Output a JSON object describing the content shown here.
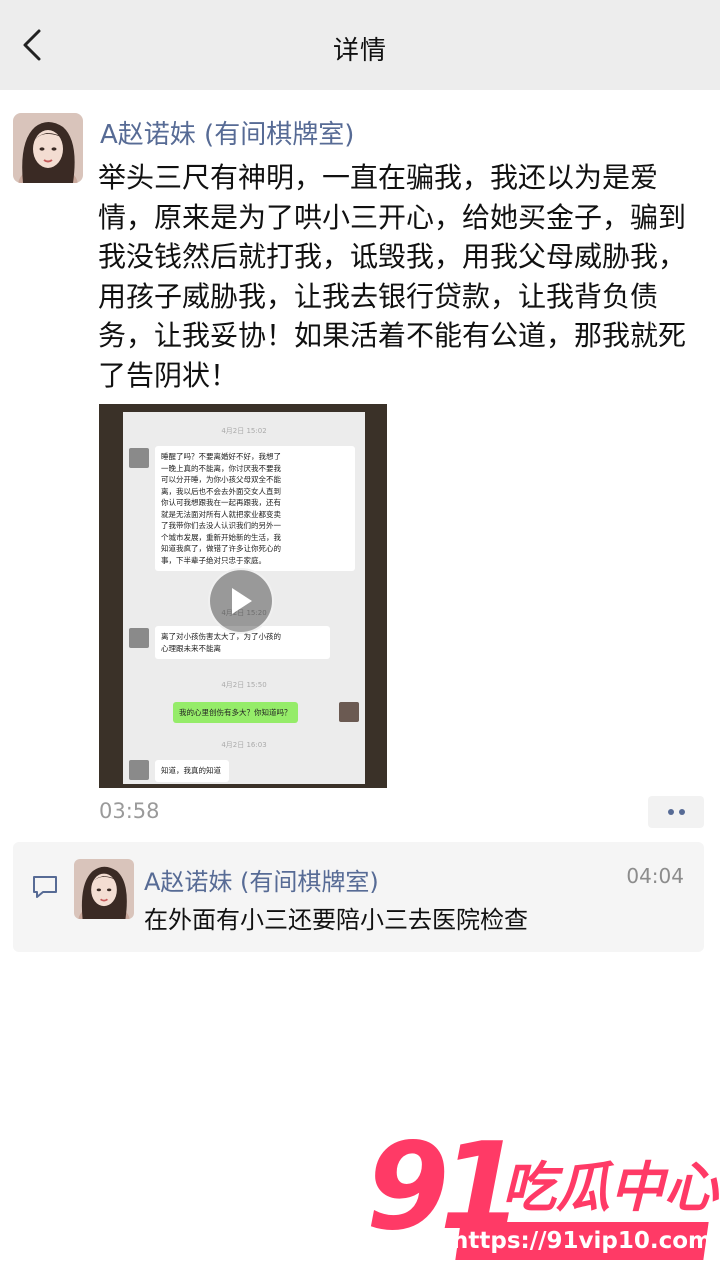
{
  "header": {
    "title": "详情",
    "back_icon": "chevron-left-icon"
  },
  "post": {
    "author": "A赵诺妹 (有间棋牌室)",
    "text_lines": [
      "举头三尺有神明，一直在骗我，我还以为是爱",
      "情，原来是为了哄小三开心，给她买金子，骗到",
      "我没钱然后就打我，诋毁我，用我父母威胁我，",
      "用孩子威胁我，让我去银行贷款，让我背负债",
      "务，让我妥协！如果活着不能有公道，那我就死",
      "了告阴状！"
    ],
    "time": "03:58",
    "media": {
      "type": "video",
      "play_icon": "play-icon",
      "chat": {
        "time1": "4月2日 15:02",
        "bubble1_lines": [
          "睡醒了吗？不要离婚好不好，我想了",
          "一晚上真的不能离，你讨厌我不要我",
          "可以分开睡，为你小孩父母双全不能",
          "离，我以后也不会去外面交女人直到",
          "你认可我想跟我在一起再跟我，还有",
          "就是无法面对所有人就把家业都变卖",
          "了我带你们去没人认识我们的另外一",
          "个城市发展，重新开始新的生活，我",
          "知道我疯了，做错了许多让你死心的",
          "事，下半辈子绝对只忠于家庭。"
        ],
        "time2": "4月2日 15:20",
        "bubble2_lines": [
          "离了对小孩伤害太大了，为了小孩的",
          "心理跟未来不能离"
        ],
        "time3": "4月2日 15:50",
        "bubble3": "我的心里创伤有多大？你知道吗？",
        "time4": "4月2日 16:03",
        "bubble4": "知道，我真的知道"
      }
    }
  },
  "comment": {
    "icon": "comment-icon",
    "author": "A赵诺妹 (有间棋牌室)",
    "time": "04:04",
    "text": "在外面有小三还要陪小三去医院检查"
  },
  "watermark": {
    "brand_number": "91",
    "brand_title": "吃瓜中心",
    "url": "https://91vip10.com"
  },
  "colors": {
    "header_bg": "#ededed",
    "link_blue": "#576b95",
    "watermark_pink": "#ff3a66"
  }
}
